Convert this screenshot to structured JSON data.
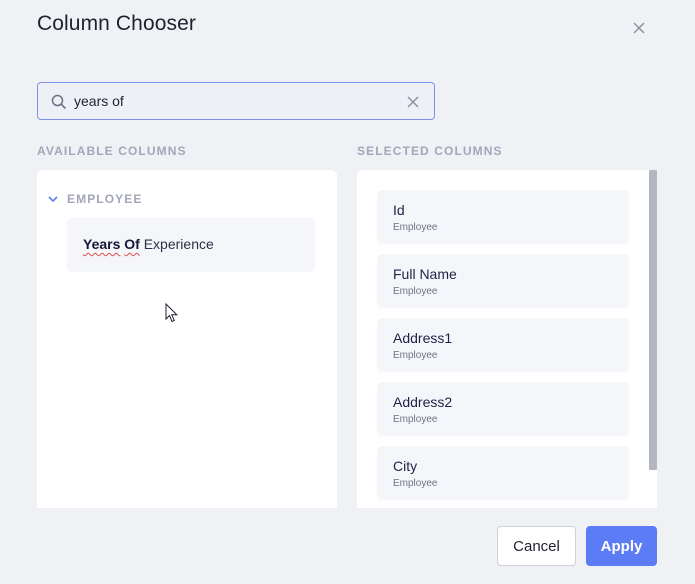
{
  "dialog": {
    "title": "Column Chooser"
  },
  "search": {
    "value": "years of",
    "placeholder": ""
  },
  "available": {
    "label": "AVAILABLE COLUMNS",
    "group_label": "EMPLOYEE",
    "item": {
      "match_first": "Years",
      "match_second": "Of",
      "rest": "Experience"
    }
  },
  "selected": {
    "label": "SELECTED COLUMNS",
    "items": [
      {
        "name": "Id",
        "group": "Employee"
      },
      {
        "name": "Full Name",
        "group": "Employee"
      },
      {
        "name": "Address1",
        "group": "Employee"
      },
      {
        "name": "Address2",
        "group": "Employee"
      },
      {
        "name": "City",
        "group": "Employee"
      }
    ]
  },
  "buttons": {
    "cancel": "Cancel",
    "apply": "Apply"
  },
  "icons": {
    "close": "close-icon",
    "search": "search-icon",
    "clear": "clear-icon",
    "collapse": "chevron-down-icon",
    "cursor": "mouse-pointer-icon"
  },
  "colors": {
    "accent": "#5b7cf5",
    "search_border": "#7c93e6",
    "background": "#f0f1f5"
  }
}
